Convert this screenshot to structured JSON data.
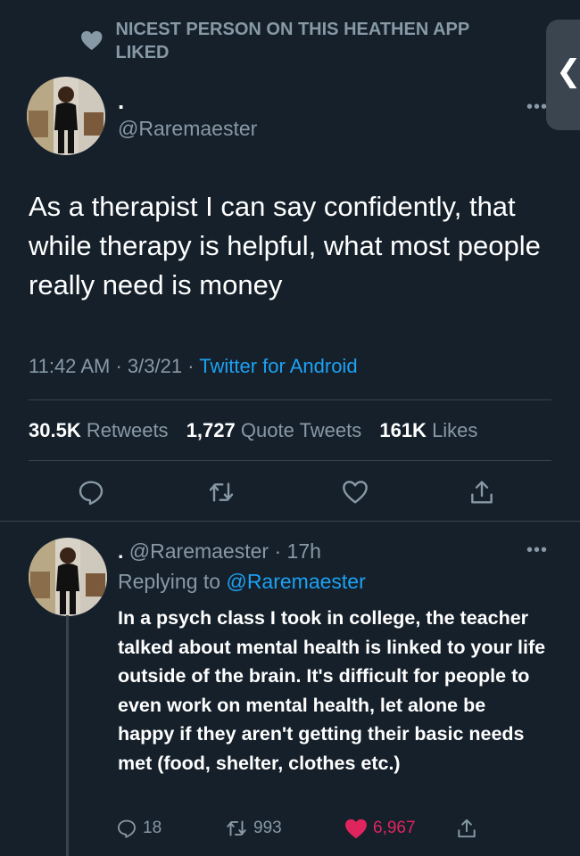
{
  "liked_header": {
    "text": "NICEST PERSON ON THIS HEATHEN APP liked"
  },
  "side_tab": {
    "chevron": "❮"
  },
  "tweet": {
    "display_name": ".",
    "handle": "@Raremaester",
    "more_icon": "more-horizontal-icon",
    "text": "As a therapist I can say confidently, that while therapy is helpful, what most people really need is money",
    "time": "11:42 AM",
    "date": "3/3/21",
    "source": "Twitter for Android",
    "stats": {
      "retweets_count": "30.5K",
      "retweets_label": "Retweets",
      "quotes_count": "1,727",
      "quotes_label": "Quote Tweets",
      "likes_count": "161K",
      "likes_label": "Likes"
    },
    "actions": [
      "reply-icon",
      "retweet-icon",
      "like-icon",
      "share-icon"
    ]
  },
  "reply": {
    "display_name": ".",
    "handle": "@Raremaester",
    "age": "17h",
    "replying_label": "Replying to",
    "replying_to": "@Raremaester",
    "text": "In a psych class I took in college, the teacher talked about mental health is linked to your life outside of the brain. It's difficult for people to even work on mental health, let alone be happy if they aren't getting their basic needs met (food, shelter, clothes etc.)",
    "reply_count": "18",
    "retweet_count": "993",
    "like_count": "6,967"
  },
  "colors": {
    "background": "#15202b",
    "secondary_text": "#8899a6",
    "accent": "#1da1f2",
    "like": "#e0245e",
    "divider": "#38444d"
  }
}
